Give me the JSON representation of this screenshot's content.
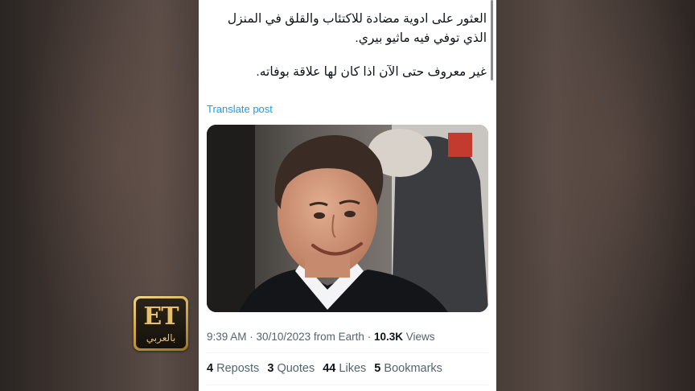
{
  "post": {
    "text_line_1": "العثور على ادوية مضادة للاكتئاب والقلق في المنزل الذي توفي فيه ماثيو بيري.",
    "text_line_2": "غير معروف حتى الآن اذا كان لها علاقة بوفاته.",
    "translate_label": "Translate post",
    "time": "9:39 AM",
    "date": "30/10/2023",
    "source": "from Earth",
    "views_count": "10.3K",
    "views_label": "Views"
  },
  "stats": [
    {
      "count": "4",
      "label": "Reposts"
    },
    {
      "count": "3",
      "label": "Quotes"
    },
    {
      "count": "44",
      "label": "Likes"
    },
    {
      "count": "5",
      "label": "Bookmarks"
    }
  ],
  "logo": {
    "text": "ET",
    "subtext": "بالعربي"
  },
  "colors": {
    "link_blue": "#1d9bf0",
    "text_primary": "#0f1419",
    "text_secondary": "#536471",
    "logo_gold": "#e8c06a"
  }
}
